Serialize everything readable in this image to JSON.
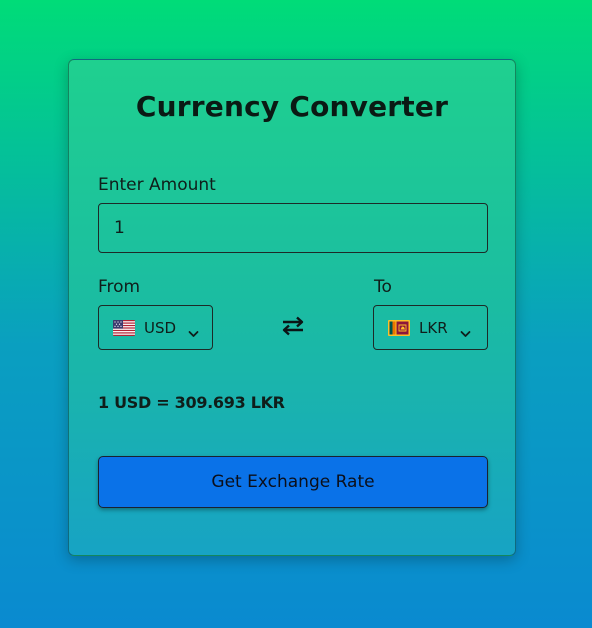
{
  "converter": {
    "title": "Currency Converter",
    "amount_label": "Enter Amount",
    "amount_value": "1",
    "from_label": "From",
    "to_label": "To",
    "from_currency": "USD",
    "from_flag_icon": "us-flag-icon",
    "to_currency": "LKR",
    "to_flag_icon": "sri-lanka-flag-icon",
    "swap_icon": "swap-arrows-icon",
    "rate_text": "1 USD = 309.693 LKR",
    "button_label": "Get Exchange Rate"
  },
  "colors": {
    "background_top": "#00dc78",
    "background_bottom": "#0a8ad0",
    "button": "#0a72e8"
  }
}
